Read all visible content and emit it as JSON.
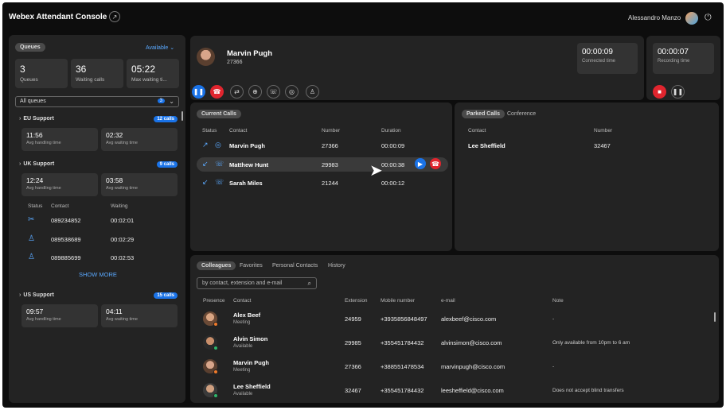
{
  "app": {
    "title": "Webex Attendant Console",
    "user": "Alessandro Manzo"
  },
  "queues": {
    "tab": "Queues",
    "availability": "Available",
    "stats": [
      {
        "value": "3",
        "label": "Queues"
      },
      {
        "value": "36",
        "label": "Waiting calls"
      },
      {
        "value": "05:22",
        "label": "Max waiting ti..."
      }
    ],
    "filter": {
      "value": "All queues",
      "count": "3"
    },
    "groups": [
      {
        "name": "EU Support",
        "calls": "12 calls",
        "avg_handling": "11:56",
        "avg_handling_label": "Avg handling time",
        "avg_waiting": "02:32",
        "avg_waiting_label": "Avg waiting time"
      },
      {
        "name": "UK Support",
        "calls": "9 calls",
        "avg_handling": "12:24",
        "avg_handling_label": "Avg handling time",
        "avg_waiting": "03:58",
        "avg_waiting_label": "Avg waiting time"
      },
      {
        "name": "US Support",
        "calls": "15 calls",
        "avg_handling": "09:57",
        "avg_handling_label": "Avg handling time",
        "avg_waiting": "04:11",
        "avg_waiting_label": "Avg waiting time"
      }
    ],
    "waiting_headers": [
      "Status",
      "Contact",
      "Waiting"
    ],
    "waiting": [
      {
        "contact": "089234852",
        "waiting": "00:02:01"
      },
      {
        "contact": "089538689",
        "waiting": "00:02:29"
      },
      {
        "contact": "089885699",
        "waiting": "00:02:53"
      }
    ],
    "show_more": "SHOW MORE"
  },
  "active_call": {
    "name": "Marvin Pugh",
    "extension": "27366",
    "connected_time": "00:00:09",
    "connected_label": "Connected time",
    "recording_time": "00:00:07",
    "recording_label": "Recording time"
  },
  "current_calls": {
    "tab": "Current Calls",
    "headers": [
      "Status",
      "Contact",
      "Number",
      "Duration"
    ],
    "rows": [
      {
        "contact": "Marvin Pugh",
        "number": "27366",
        "duration": "00:00:09"
      },
      {
        "contact": "Matthew Hunt",
        "number": "29983",
        "duration": "00:00:38"
      },
      {
        "contact": "Sarah Miles",
        "number": "21244",
        "duration": "00:00:12"
      }
    ]
  },
  "parked": {
    "tabs": [
      "Parked Calls",
      "Conference"
    ],
    "headers": [
      "Contact",
      "Number"
    ],
    "rows": [
      {
        "contact": "Lee Sheffield",
        "number": "32467"
      }
    ]
  },
  "contacts": {
    "tabs": [
      "Colleagues",
      "Favorites",
      "Personal Contacts",
      "History"
    ],
    "search_placeholder": "by contact, extension and e-mail",
    "headers": [
      "Presence",
      "Contact",
      "Extension",
      "Mobile number",
      "e-mail",
      "Note"
    ],
    "rows": [
      {
        "name": "Alex Beef",
        "status": "Meeting",
        "ext": "24959",
        "mobile": "+3935856848497",
        "email": "alexbeef@cisco.com",
        "note": "-"
      },
      {
        "name": "Alvin Simon",
        "status": "Available",
        "ext": "29985",
        "mobile": "+355451784432",
        "email": "alvinsimon@cisco.com",
        "note": "Only available from 10pm to 6 am"
      },
      {
        "name": "Marvin Pugh",
        "status": "Meeting",
        "ext": "27366",
        "mobile": "+388551478534",
        "email": "marvinpugh@cisco.com",
        "note": "-"
      },
      {
        "name": "Lee Sheffield",
        "status": "Available",
        "ext": "32467",
        "mobile": "+355451784432",
        "email": "leesheffield@cisco.com",
        "note": "Does not accept blind transfers"
      }
    ]
  },
  "colors": {
    "accent": "#1a73e8",
    "danger": "#e0252e",
    "link": "#5aa9ff",
    "meeting": "#f07a2a",
    "available": "#2fb56b"
  }
}
